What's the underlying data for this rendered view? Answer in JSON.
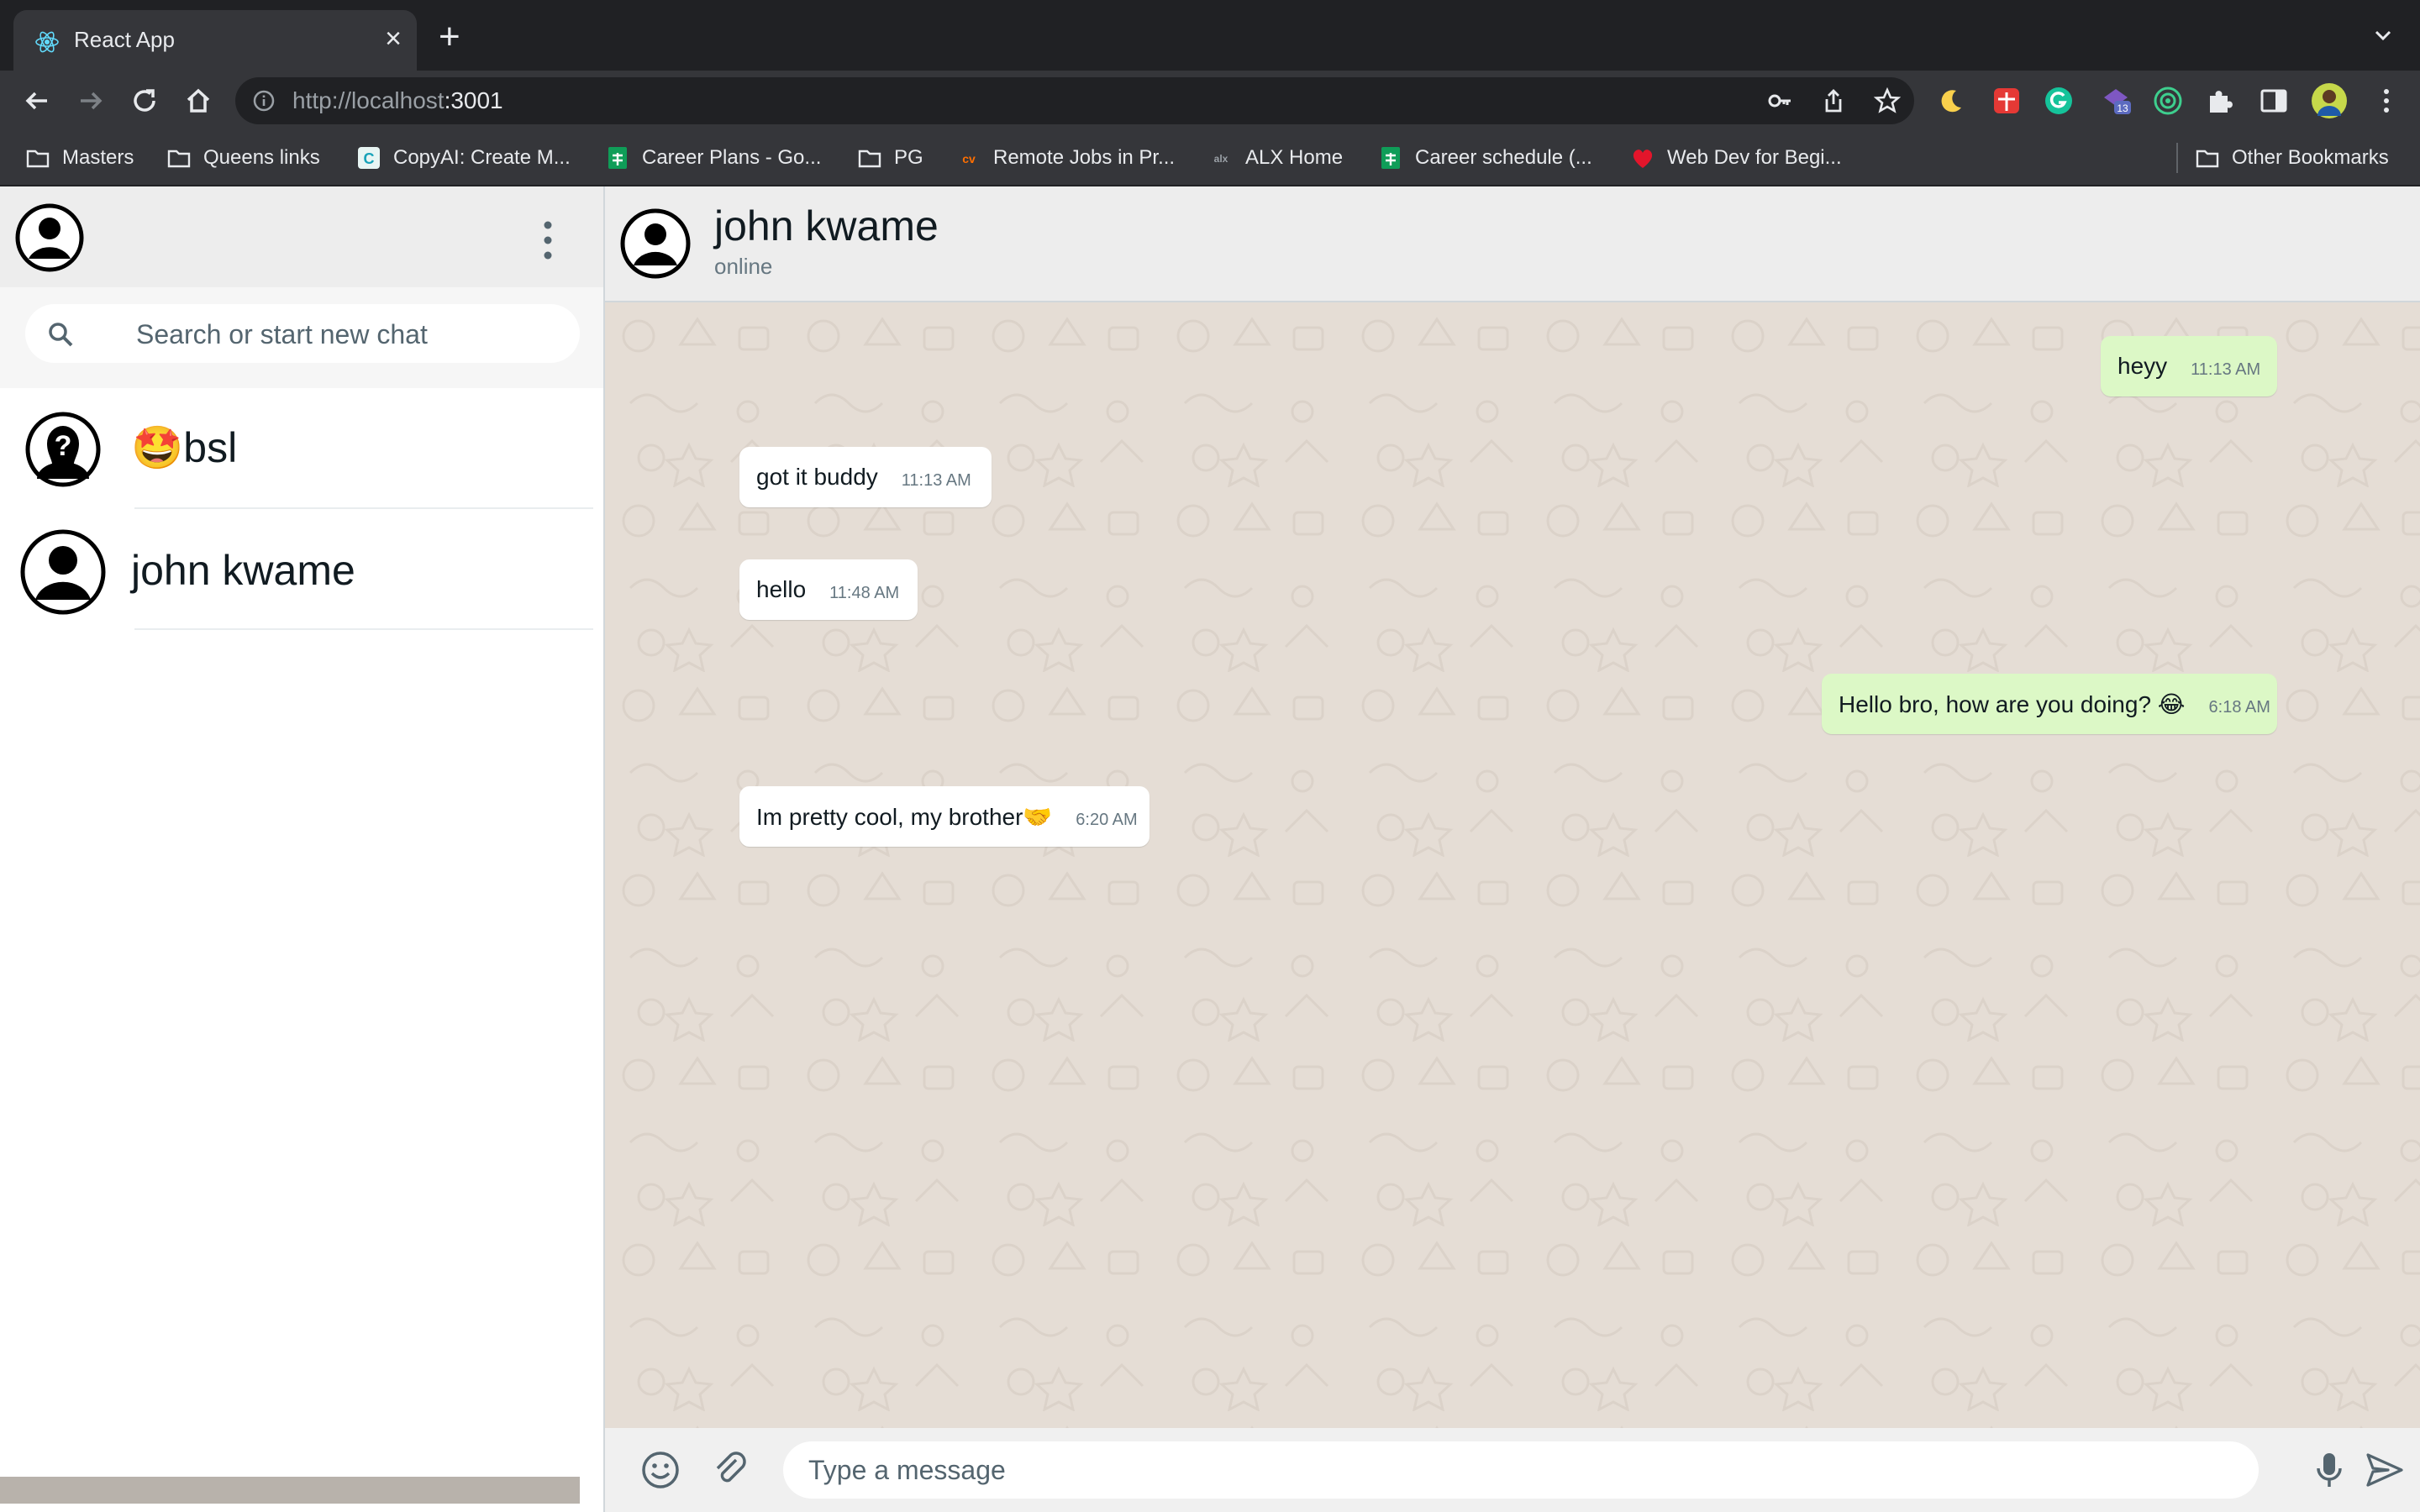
{
  "browser": {
    "tab_title": "React App",
    "new_tab": "+",
    "close": "×",
    "url_scheme_host": "http://localhost",
    "url_port": ":3001",
    "bookmarks": [
      {
        "label": "Masters",
        "icon": "folder-icon"
      },
      {
        "label": "Queens links",
        "icon": "folder-icon"
      },
      {
        "label": "CopyAI: Create M...",
        "icon": "copyai-icon"
      },
      {
        "label": "Career Plans - Go...",
        "icon": "sheets-icon"
      },
      {
        "label": "PG",
        "icon": "folder-icon"
      },
      {
        "label": "Remote Jobs in Pr...",
        "icon": "cv-icon"
      },
      {
        "label": "ALX Home",
        "icon": "alx-icon"
      },
      {
        "label": "Career schedule (...",
        "icon": "sheets-icon"
      },
      {
        "label": "Web Dev for Begi...",
        "icon": "heart-icon"
      }
    ],
    "other_bookmarks": "Other Bookmarks",
    "extension_badge": "13"
  },
  "sidebar": {
    "search_placeholder": "Search or start new chat",
    "chats": [
      {
        "name": "🤩bsl",
        "avatar": "unknown-user-avatar"
      },
      {
        "name": "john kwame",
        "avatar": "user-avatar"
      }
    ]
  },
  "chat": {
    "contact_name": "john kwame",
    "status": "online",
    "messages": [
      {
        "text": "heyy",
        "time": "11:13 AM",
        "direction": "out"
      },
      {
        "text": "got it buddy",
        "time": "11:13 AM",
        "direction": "in"
      },
      {
        "text": "hello",
        "time": "11:48 AM",
        "direction": "in"
      },
      {
        "text": "Hello bro, how are you doing? 😂",
        "time": "6:18 AM",
        "direction": "out"
      },
      {
        "text": "Im pretty cool, my brother🤝",
        "time": "6:20 AM",
        "direction": "in"
      }
    ],
    "input_placeholder": "Type a message"
  },
  "colors": {
    "outgoing_bubble": "#dcf8c6",
    "incoming_bubble": "#ffffff",
    "chat_background": "#e5ddd5",
    "header_background": "#ededed"
  }
}
